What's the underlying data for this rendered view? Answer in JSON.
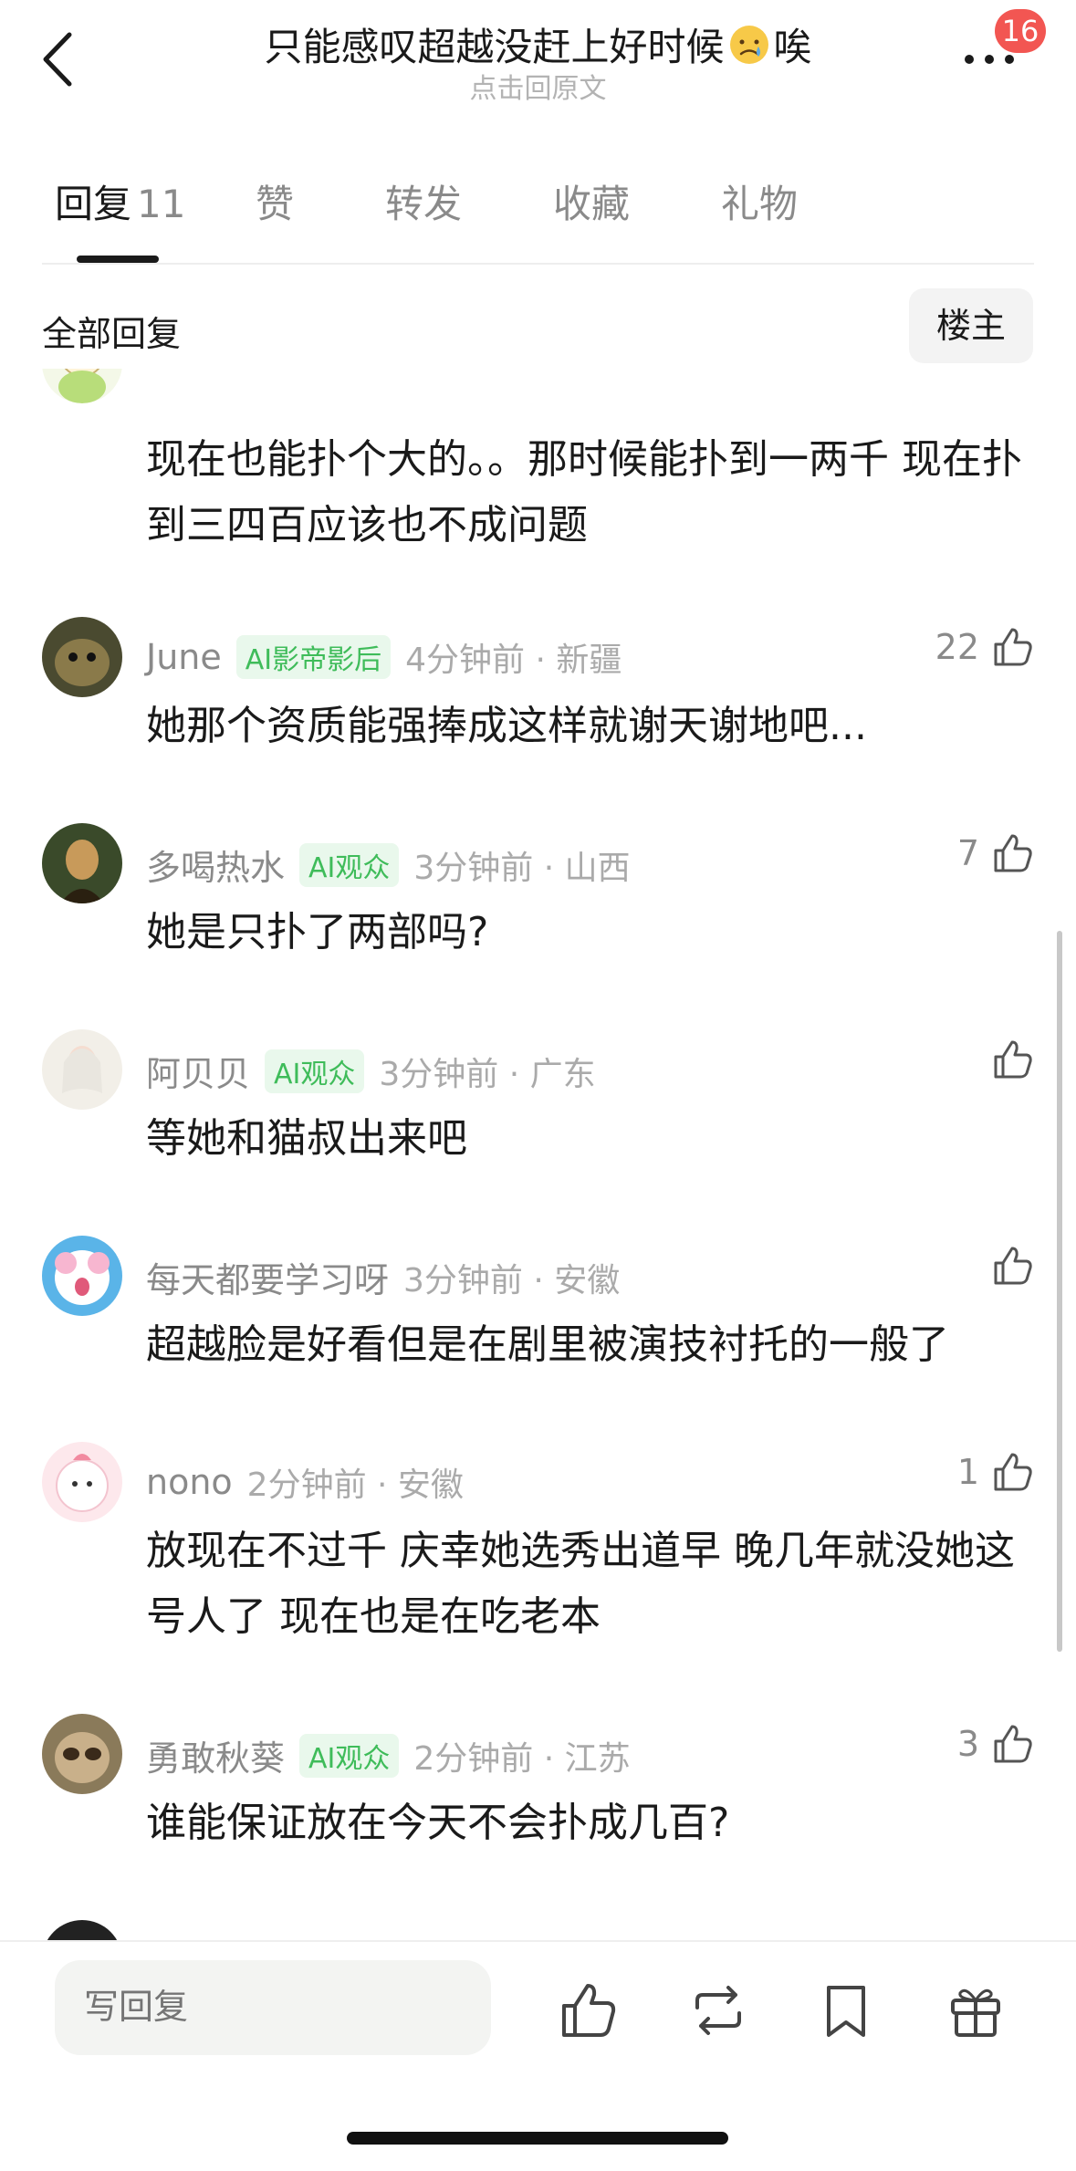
{
  "header": {
    "title_before": "只能感叹超越没赶上好时候",
    "title_after": "唉",
    "subtitle": "点击回原文",
    "notification_count": "16"
  },
  "tabs": [
    {
      "label": "回复",
      "count": "11",
      "active": true
    },
    {
      "label": "赞"
    },
    {
      "label": "转发"
    },
    {
      "label": "收藏"
    },
    {
      "label": "礼物"
    }
  ],
  "filter": {
    "label": "全部回复",
    "op_button": "楼主"
  },
  "comments": [
    {
      "text": "现在也能扑个大的。。那时候能扑到一两千 现在扑到三四百应该也不成问题"
    },
    {
      "name": "June",
      "tag": "AI影帝影后",
      "time": "4分钟前 · 新疆",
      "likes": "22",
      "text": "她那个资质能强捧成这样就谢天谢地吧..."
    },
    {
      "name": "多喝热水",
      "tag": "AI观众",
      "time": "3分钟前 · 山西",
      "likes": "7",
      "text": "她是只扑了两部吗?"
    },
    {
      "name": "阿贝贝",
      "tag": "AI观众",
      "time": "3分钟前 · 广东",
      "likes": "",
      "text": "等她和猫叔出来吧"
    },
    {
      "name": "每天都要学习呀",
      "tag": "",
      "time": "3分钟前 · 安徽",
      "likes": "",
      "text": "超越脸是好看但是在剧里被演技衬托的一般了"
    },
    {
      "name": "nono",
      "tag": "",
      "time": "2分钟前 · 安徽",
      "likes": "1",
      "text": "放现在不过千 庆幸她选秀出道早 晚几年就没她这号人了 现在也是在吃老本"
    },
    {
      "name": "勇敢秋葵",
      "tag": "AI观众",
      "time": "2分钟前 · 江苏",
      "likes": "3",
      "text": "谁能保证放在今天不会扑成几百?"
    }
  ],
  "bottom_bar": {
    "reply_placeholder": "写回复"
  },
  "colors": {
    "tag_green": "#3fbc5a",
    "tag_bg": "#e9f8ec",
    "badge_red": "#f25652"
  }
}
